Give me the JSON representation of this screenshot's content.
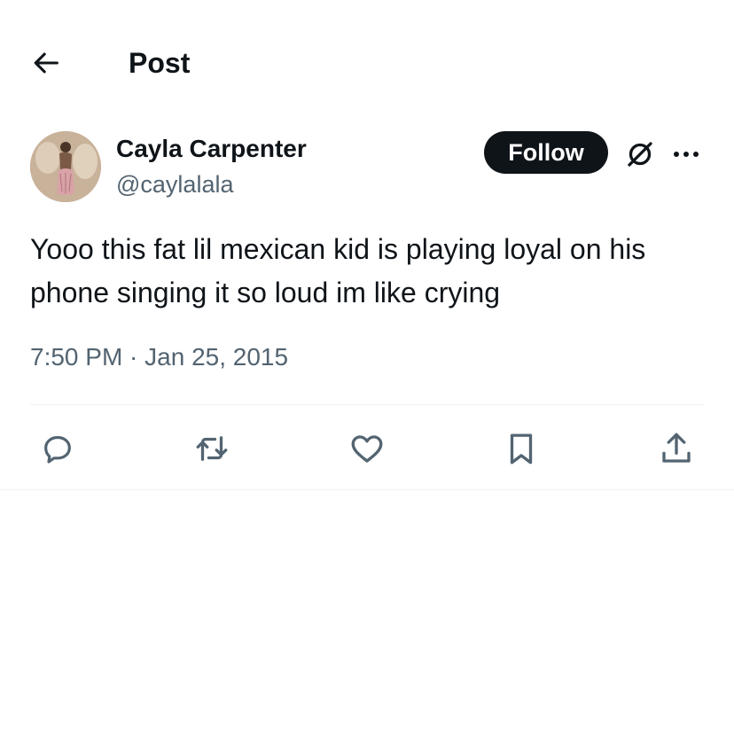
{
  "header": {
    "title": "Post",
    "back_icon": "arrow-left-icon"
  },
  "author": {
    "display_name": "Cayla Carpenter",
    "handle": "@caylalala",
    "follow_label": "Follow"
  },
  "tweet": {
    "text": "Yooo this fat lil mexican kid is playing loyal on his phone singing it so loud im like crying",
    "timestamp": "7:50 PM · Jan 25, 2015"
  },
  "actions": {
    "icons": [
      "reply-icon",
      "retweet-icon",
      "like-icon",
      "bookmark-icon",
      "share-icon"
    ]
  },
  "colors": {
    "text_primary": "#0f1419",
    "text_secondary": "#536471",
    "divider": "#eff3f4",
    "follow_bg": "#0f1419",
    "follow_text": "#ffffff"
  }
}
